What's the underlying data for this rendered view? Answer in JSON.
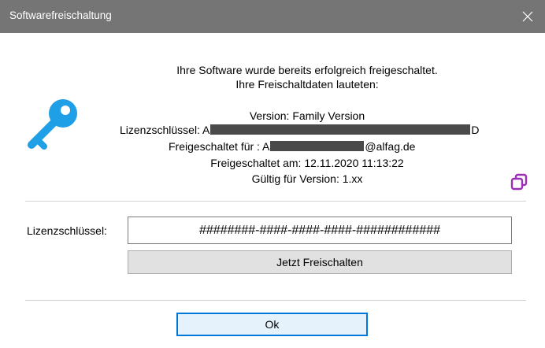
{
  "window": {
    "title": "Softwarefreischaltung",
    "close_icon": "close-icon"
  },
  "info": {
    "line1": "Ihre Software wurde bereits erfolgreich freigeschaltet.",
    "line2": "Ihre Freischaltdaten lauteten:",
    "version": "Version: Family Version",
    "license_label": "Lizenzschlüssel: A",
    "license_end": "D",
    "activated_for_label": "Freigeschaltet für : A",
    "activated_for_domain": "@alfag.de",
    "activated_at": "Freigeschaltet am: 12.11.2020 11:13:22",
    "valid_for": "Gültig für Version: 1.xx"
  },
  "icons": {
    "key": "key-icon",
    "copy": "copy-icon",
    "key_color": "#1e9fe6",
    "copy_color": "#9b2fb5"
  },
  "form": {
    "license_label": "Lizenzschlüssel:",
    "license_value": "########-####-####-####-############",
    "activate_button": "Jetzt Freischalten"
  },
  "footer": {
    "ok_button": "Ok"
  },
  "colors": {
    "titlebar_bg": "#757575",
    "ok_border": "#0078d7",
    "button_bg": "#e1e1e1"
  }
}
